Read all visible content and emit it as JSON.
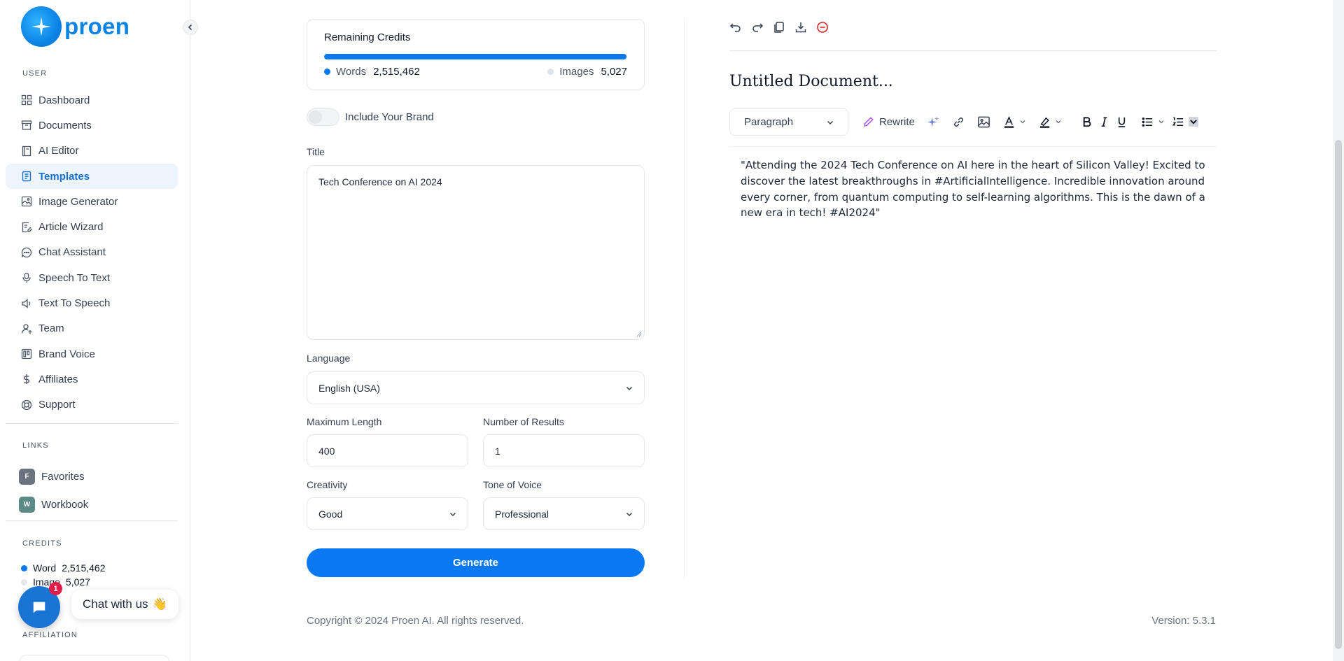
{
  "brand": {
    "name": "proen"
  },
  "sidebar": {
    "user_label": "USER",
    "items": [
      {
        "label": "Dashboard",
        "icon": "grid-icon"
      },
      {
        "label": "Documents",
        "icon": "archive-icon"
      },
      {
        "label": "AI Editor",
        "icon": "book-icon"
      },
      {
        "label": "Templates",
        "icon": "file-text-icon",
        "active": true
      },
      {
        "label": "Image Generator",
        "icon": "image-icon"
      },
      {
        "label": "Article Wizard",
        "icon": "file-edit-icon"
      },
      {
        "label": "Chat Assistant",
        "icon": "message-circle-icon"
      },
      {
        "label": "Speech To Text",
        "icon": "microphone-icon"
      },
      {
        "label": "Text To Speech",
        "icon": "speaker-icon"
      },
      {
        "label": "Team",
        "icon": "user-plus-icon"
      },
      {
        "label": "Brand Voice",
        "icon": "layout-icon"
      },
      {
        "label": "Affiliates",
        "icon": "dollar-icon"
      },
      {
        "label": "Support",
        "icon": "lifebuoy-icon"
      }
    ],
    "links_label": "LINKS",
    "links": [
      {
        "badge": "F",
        "label": "Favorites",
        "color": "#6b7280"
      },
      {
        "badge": "W",
        "label": "Workbook",
        "color": "#5b8a87"
      }
    ],
    "credits_label": "CREDITS",
    "credits": {
      "word_label": "Word",
      "word_value": "2,515,462",
      "image_label": "Image",
      "image_value": "5,027"
    },
    "affiliation_label": "AFFILIATION"
  },
  "chat_widget": {
    "label": "Chat with us",
    "emoji": "👋",
    "badge": "1"
  },
  "remaining_credits": {
    "title": "Remaining Credits",
    "words_label": "Words",
    "words_value": "2,515,462",
    "images_label": "Images",
    "images_value": "5,027",
    "progress_fraction": 0.998
  },
  "form": {
    "brand_toggle_label": "Include Your Brand",
    "title_label": "Title",
    "title_value": "Tech Conference on AI 2024",
    "language_label": "Language",
    "language_value": "English (USA)",
    "max_length_label": "Maximum Length",
    "max_length_value": "400",
    "num_results_label": "Number of Results",
    "num_results_value": "1",
    "creativity_label": "Creativity",
    "creativity_value": "Good",
    "tone_label": "Tone of Voice",
    "tone_value": "Professional",
    "generate_label": "Generate"
  },
  "editor": {
    "doc_title": "Untitled Document...",
    "paragraph_style": "Paragraph",
    "rewrite_label": "Rewrite",
    "content": "\"Attending the 2024 Tech Conference on AI here in the heart of Silicon Valley! Excited to discover the latest breakthroughs in #ArtificialIntelligence. Incredible innovation around every corner, from quantum computing to self-learning algorithms. This is the dawn of a new era in tech! #AI2024\""
  },
  "footer": {
    "copyright": "Copyright © 2024 Proen AI. All rights reserved.",
    "version": "Version: 5.3.1"
  },
  "colors": {
    "accent": "#0a78f0",
    "active_bg": "#eef4fc",
    "danger": "#e11d48"
  }
}
